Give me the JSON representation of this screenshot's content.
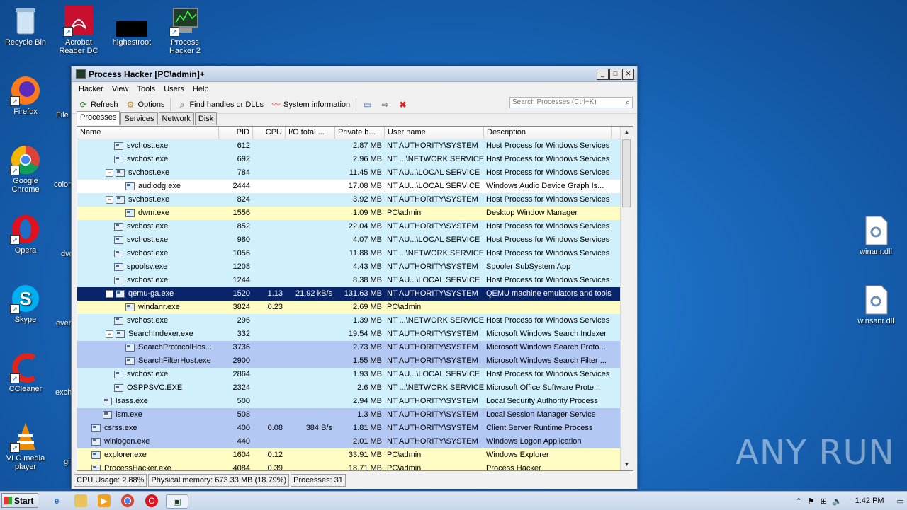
{
  "desktop": {
    "icons": [
      {
        "label": "Recycle Bin",
        "icon": "recycle-bin-icon"
      },
      {
        "label": "Acrobat Reader DC",
        "icon": "acrobat-icon"
      },
      {
        "label": "highestroot",
        "icon": "folder-icon"
      },
      {
        "label": "Process Hacker 2",
        "icon": "process-hacker-icon"
      },
      {
        "label": "Firefox",
        "icon": "firefox-icon"
      },
      {
        "label": "Google Chrome",
        "icon": "chrome-icon"
      },
      {
        "label": "Opera",
        "icon": "opera-icon"
      },
      {
        "label": "Skype",
        "icon": "skype-icon"
      },
      {
        "label": "CCleaner",
        "icon": "ccleaner-icon"
      },
      {
        "label": "VLC media player",
        "icon": "vlc-icon"
      },
      {
        "label": "winanr.dll",
        "icon": "dll-file-icon"
      },
      {
        "label": "winsanr.dll",
        "icon": "dll-file-icon"
      }
    ],
    "partial_labels": [
      "File",
      "color",
      "dvd",
      "ever",
      "exch",
      "gi"
    ],
    "watermark": "ANY RUN"
  },
  "window": {
    "title": "Process Hacker [PC\\admin]+",
    "menu": [
      "Hacker",
      "View",
      "Tools",
      "Users",
      "Help"
    ],
    "toolbar": {
      "refresh": "Refresh",
      "options": "Options",
      "find_handles": "Find handles or DLLs",
      "system_info": "System information"
    },
    "search_placeholder": "Search Processes (Ctrl+K)",
    "tabs": [
      "Processes",
      "Services",
      "Network",
      "Disk"
    ],
    "columns": [
      "Name",
      "PID",
      "CPU",
      "I/O total ...",
      "Private b...",
      "User name",
      "Description"
    ],
    "rows": [
      {
        "indent": 3,
        "toggle": "",
        "name": "svchost.exe",
        "pid": "612",
        "cpu": "",
        "io": "",
        "priv": "2.87 MB",
        "user": "NT AUTHORITY\\SYSTEM",
        "desc": "Host Process for Windows Services",
        "style": "svc"
      },
      {
        "indent": 3,
        "toggle": "",
        "name": "svchost.exe",
        "pid": "692",
        "cpu": "",
        "io": "",
        "priv": "2.96 MB",
        "user": "NT ...\\NETWORK SERVICE",
        "desc": "Host Process for Windows Services",
        "style": "svc"
      },
      {
        "indent": 3,
        "toggle": "−",
        "name": "svchost.exe",
        "pid": "784",
        "cpu": "",
        "io": "",
        "priv": "11.45 MB",
        "user": "NT AU...\\LOCAL SERVICE",
        "desc": "Host Process for Windows Services",
        "style": "svc"
      },
      {
        "indent": 4,
        "toggle": "",
        "name": "audiodg.exe",
        "pid": "2444",
        "cpu": "",
        "io": "",
        "priv": "17.08 MB",
        "user": "NT AU...\\LOCAL SERVICE",
        "desc": "Windows Audio Device Graph Is...",
        "style": "wht"
      },
      {
        "indent": 3,
        "toggle": "−",
        "name": "svchost.exe",
        "pid": "824",
        "cpu": "",
        "io": "",
        "priv": "3.92 MB",
        "user": "NT AUTHORITY\\SYSTEM",
        "desc": "Host Process for Windows Services",
        "style": "svc"
      },
      {
        "indent": 4,
        "toggle": "",
        "name": "dwm.exe",
        "pid": "1556",
        "cpu": "",
        "io": "",
        "priv": "1.09 MB",
        "user": "PC\\admin",
        "desc": "Desktop Window Manager",
        "style": "own"
      },
      {
        "indent": 3,
        "toggle": "",
        "name": "svchost.exe",
        "pid": "852",
        "cpu": "",
        "io": "",
        "priv": "22.04 MB",
        "user": "NT AUTHORITY\\SYSTEM",
        "desc": "Host Process for Windows Services",
        "style": "svc"
      },
      {
        "indent": 3,
        "toggle": "",
        "name": "svchost.exe",
        "pid": "980",
        "cpu": "",
        "io": "",
        "priv": "4.07 MB",
        "user": "NT AU...\\LOCAL SERVICE",
        "desc": "Host Process for Windows Services",
        "style": "svc"
      },
      {
        "indent": 3,
        "toggle": "",
        "name": "svchost.exe",
        "pid": "1056",
        "cpu": "",
        "io": "",
        "priv": "11.88 MB",
        "user": "NT ...\\NETWORK SERVICE",
        "desc": "Host Process for Windows Services",
        "style": "svc"
      },
      {
        "indent": 3,
        "toggle": "",
        "name": "spoolsv.exe",
        "pid": "1208",
        "cpu": "",
        "io": "",
        "priv": "4.43 MB",
        "user": "NT AUTHORITY\\SYSTEM",
        "desc": "Spooler SubSystem App",
        "style": "svc"
      },
      {
        "indent": 3,
        "toggle": "",
        "name": "svchost.exe",
        "pid": "1244",
        "cpu": "",
        "io": "",
        "priv": "8.38 MB",
        "user": "NT AU...\\LOCAL SERVICE",
        "desc": "Host Process for Windows Services",
        "style": "svc"
      },
      {
        "indent": 3,
        "toggle": "−",
        "name": "qemu-ga.exe",
        "pid": "1520",
        "cpu": "1.13",
        "io": "21.92 kB/s",
        "priv": "131.63 MB",
        "user": "NT AUTHORITY\\SYSTEM",
        "desc": "QEMU machine emulators and tools",
        "style": "sel"
      },
      {
        "indent": 4,
        "toggle": "",
        "name": "windanr.exe",
        "pid": "3824",
        "cpu": "0.23",
        "io": "",
        "priv": "2.69 MB",
        "user": "PC\\admin",
        "desc": "",
        "style": "own"
      },
      {
        "indent": 3,
        "toggle": "",
        "name": "svchost.exe",
        "pid": "296",
        "cpu": "",
        "io": "",
        "priv": "1.39 MB",
        "user": "NT ...\\NETWORK SERVICE",
        "desc": "Host Process for Windows Services",
        "style": "svc"
      },
      {
        "indent": 3,
        "toggle": "−",
        "name": "SearchIndexer.exe",
        "pid": "332",
        "cpu": "",
        "io": "",
        "priv": "19.54 MB",
        "user": "NT AUTHORITY\\SYSTEM",
        "desc": "Microsoft Windows Search Indexer",
        "style": "svc"
      },
      {
        "indent": 4,
        "toggle": "",
        "name": "SearchProtocolHos...",
        "pid": "3736",
        "cpu": "",
        "io": "",
        "priv": "2.73 MB",
        "user": "NT AUTHORITY\\SYSTEM",
        "desc": "Microsoft Windows Search Proto...",
        "style": "sys"
      },
      {
        "indent": 4,
        "toggle": "",
        "name": "SearchFilterHost.exe",
        "pid": "2900",
        "cpu": "",
        "io": "",
        "priv": "1.55 MB",
        "user": "NT AUTHORITY\\SYSTEM",
        "desc": "Microsoft Windows Search Filter ...",
        "style": "sys"
      },
      {
        "indent": 3,
        "toggle": "",
        "name": "svchost.exe",
        "pid": "2864",
        "cpu": "",
        "io": "",
        "priv": "1.93 MB",
        "user": "NT AU...\\LOCAL SERVICE",
        "desc": "Host Process for Windows Services",
        "style": "svc"
      },
      {
        "indent": 3,
        "toggle": "",
        "name": "OSPPSVC.EXE",
        "pid": "2324",
        "cpu": "",
        "io": "",
        "priv": "2.6 MB",
        "user": "NT ...\\NETWORK SERVICE",
        "desc": "Microsoft Office Software Prote...",
        "style": "svc"
      },
      {
        "indent": 2,
        "toggle": "",
        "name": "lsass.exe",
        "pid": "500",
        "cpu": "",
        "io": "",
        "priv": "2.94 MB",
        "user": "NT AUTHORITY\\SYSTEM",
        "desc": "Local Security Authority Process",
        "style": "svc"
      },
      {
        "indent": 2,
        "toggle": "",
        "name": "lsm.exe",
        "pid": "508",
        "cpu": "",
        "io": "",
        "priv": "1.3 MB",
        "user": "NT AUTHORITY\\SYSTEM",
        "desc": "Local Session Manager Service",
        "style": "sys"
      },
      {
        "indent": 1,
        "toggle": "",
        "name": "csrss.exe",
        "pid": "400",
        "cpu": "0.08",
        "io": "384 B/s",
        "priv": "1.81 MB",
        "user": "NT AUTHORITY\\SYSTEM",
        "desc": "Client Server Runtime Process",
        "style": "sys"
      },
      {
        "indent": 1,
        "toggle": "",
        "name": "winlogon.exe",
        "pid": "440",
        "cpu": "",
        "io": "",
        "priv": "2.01 MB",
        "user": "NT AUTHORITY\\SYSTEM",
        "desc": "Windows Logon Application",
        "style": "sys"
      },
      {
        "indent": 1,
        "toggle": "",
        "name": "explorer.exe",
        "pid": "1604",
        "cpu": "0.12",
        "io": "",
        "priv": "33.91 MB",
        "user": "PC\\admin",
        "desc": "Windows Explorer",
        "style": "own"
      },
      {
        "indent": 1,
        "toggle": "",
        "name": "ProcessHacker.exe",
        "pid": "4084",
        "cpu": "0.39",
        "io": "",
        "priv": "18.71 MB",
        "user": "PC\\admin",
        "desc": "Process Hacker",
        "style": "own"
      }
    ],
    "status": {
      "cpu": "CPU Usage: 2.88%",
      "memory": "Physical memory: 673.33 MB (18.79%)",
      "processes": "Processes: 31"
    }
  },
  "taskbar": {
    "start": "Start",
    "clock": "1:42 PM"
  }
}
